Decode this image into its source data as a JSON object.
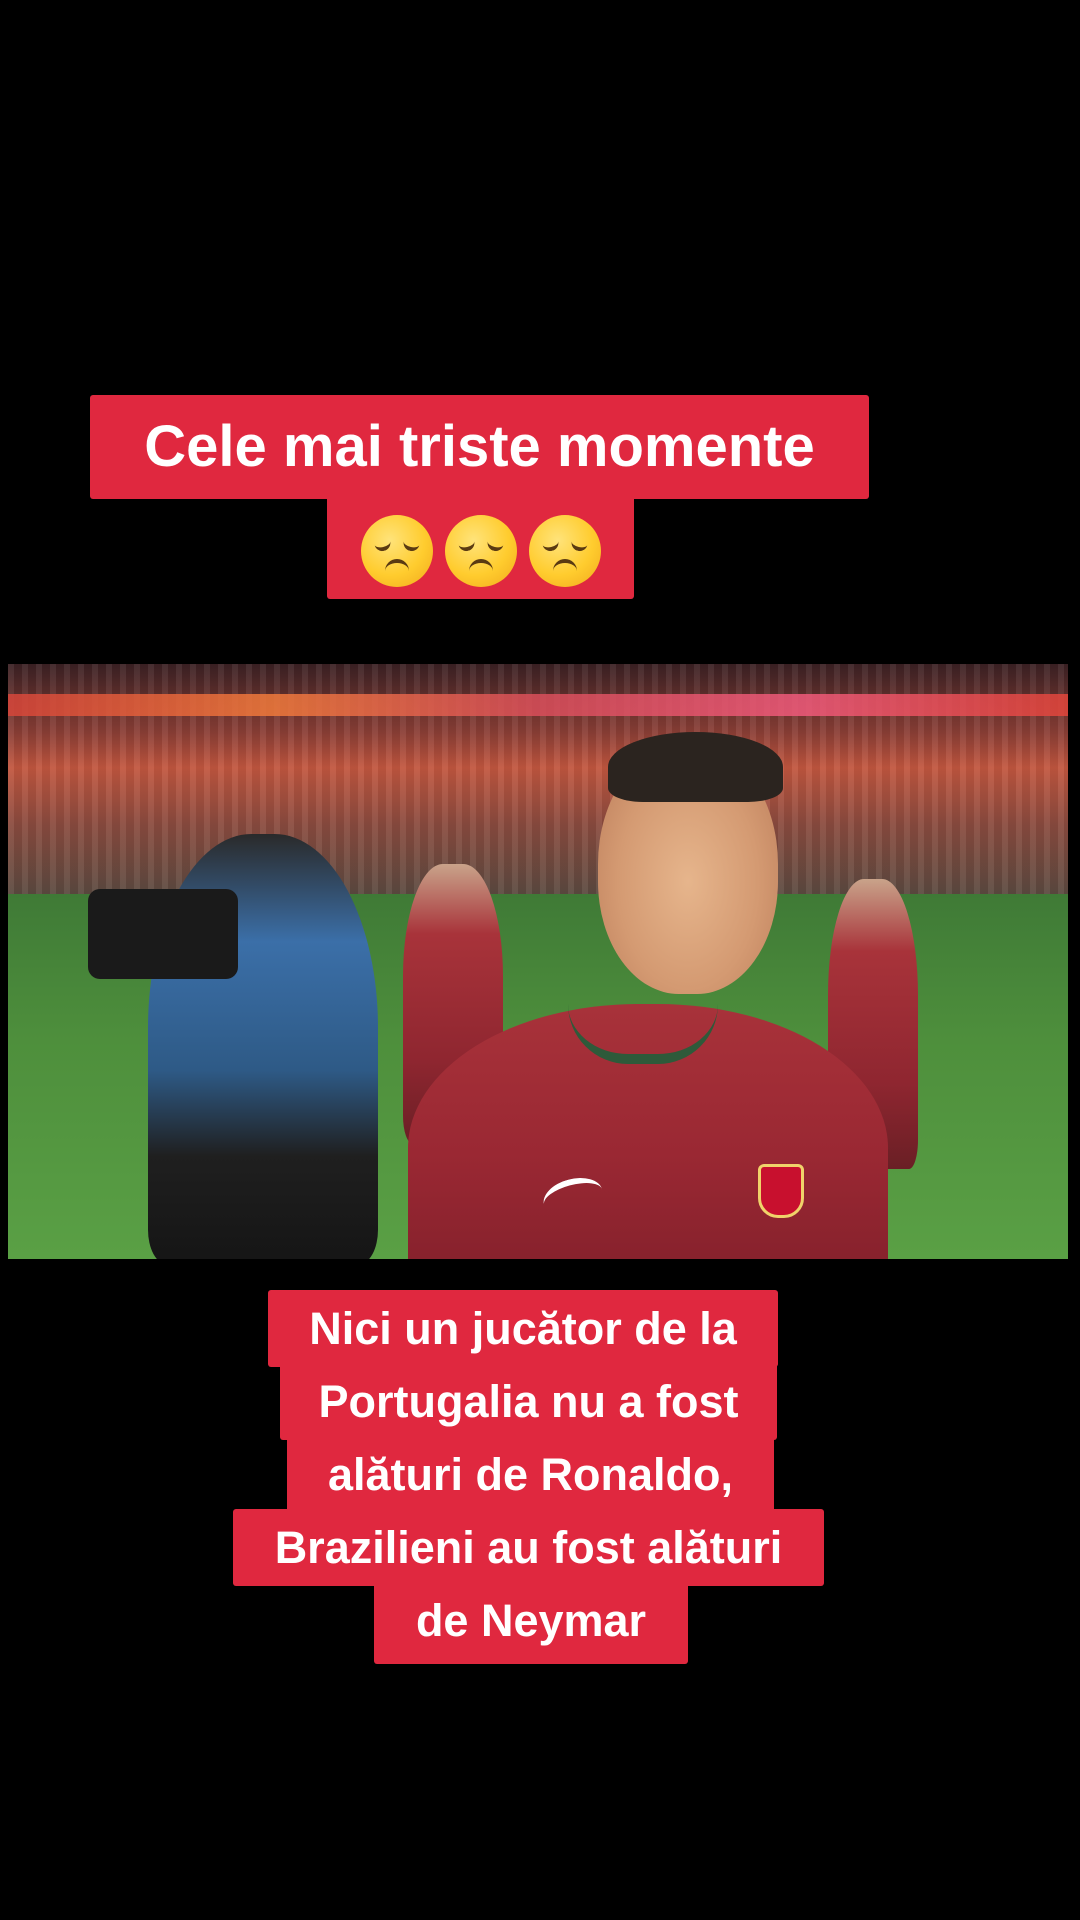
{
  "top_caption": {
    "line1": "Cele mai triste momente",
    "emoji": [
      "disappointed-face-emoji",
      "disappointed-face-emoji",
      "disappointed-face-emoji"
    ]
  },
  "video": {
    "description_icon": "video-still"
  },
  "bottom_caption": {
    "lines": [
      "Nici un jucător de la",
      "Portugalia nu a fost",
      "alături de Ronaldo,",
      "Brazilieni au fost alături",
      "de Neymar"
    ]
  },
  "colors": {
    "background": "#000000",
    "caption_bg": "#e0283f",
    "caption_text": "#ffffff"
  }
}
